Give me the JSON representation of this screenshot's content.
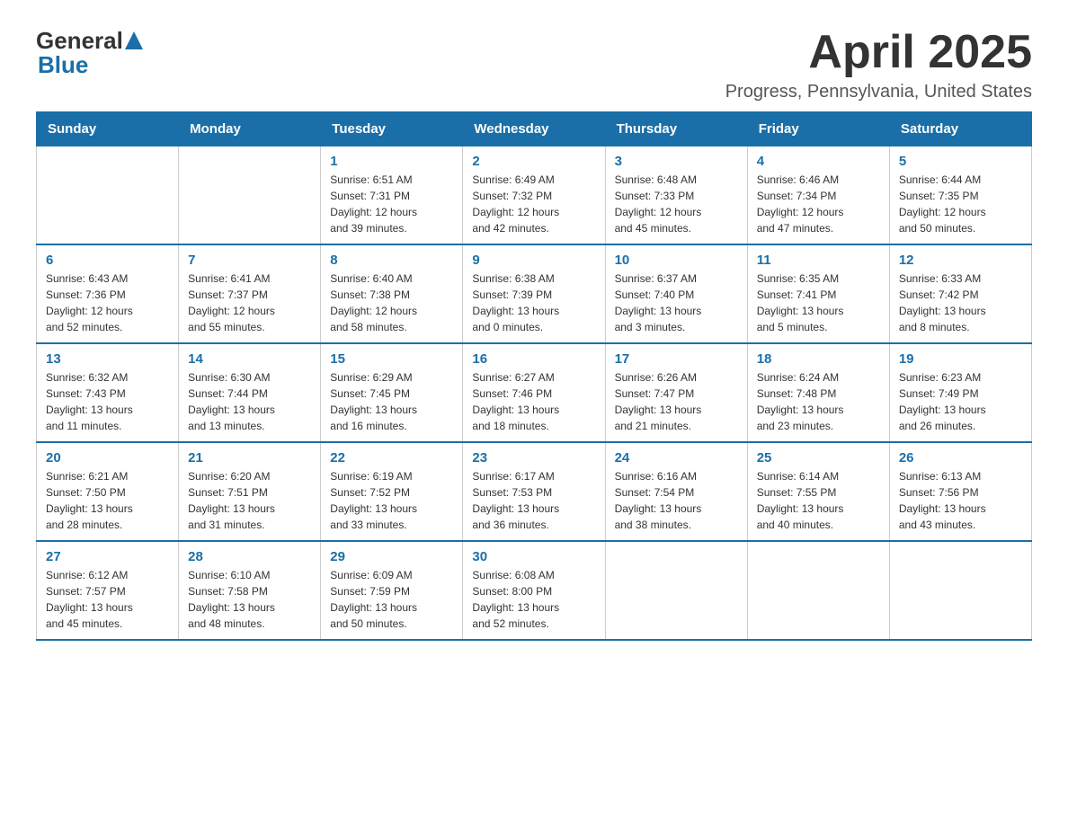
{
  "logo": {
    "general": "General",
    "triangle_color": "#1a6fa8",
    "blue": "Blue"
  },
  "title": "April 2025",
  "subtitle": "Progress, Pennsylvania, United States",
  "days_of_week": [
    "Sunday",
    "Monday",
    "Tuesday",
    "Wednesday",
    "Thursday",
    "Friday",
    "Saturday"
  ],
  "weeks": [
    [
      {
        "day": "",
        "info": ""
      },
      {
        "day": "",
        "info": ""
      },
      {
        "day": "1",
        "info": "Sunrise: 6:51 AM\nSunset: 7:31 PM\nDaylight: 12 hours\nand 39 minutes."
      },
      {
        "day": "2",
        "info": "Sunrise: 6:49 AM\nSunset: 7:32 PM\nDaylight: 12 hours\nand 42 minutes."
      },
      {
        "day": "3",
        "info": "Sunrise: 6:48 AM\nSunset: 7:33 PM\nDaylight: 12 hours\nand 45 minutes."
      },
      {
        "day": "4",
        "info": "Sunrise: 6:46 AM\nSunset: 7:34 PM\nDaylight: 12 hours\nand 47 minutes."
      },
      {
        "day": "5",
        "info": "Sunrise: 6:44 AM\nSunset: 7:35 PM\nDaylight: 12 hours\nand 50 minutes."
      }
    ],
    [
      {
        "day": "6",
        "info": "Sunrise: 6:43 AM\nSunset: 7:36 PM\nDaylight: 12 hours\nand 52 minutes."
      },
      {
        "day": "7",
        "info": "Sunrise: 6:41 AM\nSunset: 7:37 PM\nDaylight: 12 hours\nand 55 minutes."
      },
      {
        "day": "8",
        "info": "Sunrise: 6:40 AM\nSunset: 7:38 PM\nDaylight: 12 hours\nand 58 minutes."
      },
      {
        "day": "9",
        "info": "Sunrise: 6:38 AM\nSunset: 7:39 PM\nDaylight: 13 hours\nand 0 minutes."
      },
      {
        "day": "10",
        "info": "Sunrise: 6:37 AM\nSunset: 7:40 PM\nDaylight: 13 hours\nand 3 minutes."
      },
      {
        "day": "11",
        "info": "Sunrise: 6:35 AM\nSunset: 7:41 PM\nDaylight: 13 hours\nand 5 minutes."
      },
      {
        "day": "12",
        "info": "Sunrise: 6:33 AM\nSunset: 7:42 PM\nDaylight: 13 hours\nand 8 minutes."
      }
    ],
    [
      {
        "day": "13",
        "info": "Sunrise: 6:32 AM\nSunset: 7:43 PM\nDaylight: 13 hours\nand 11 minutes."
      },
      {
        "day": "14",
        "info": "Sunrise: 6:30 AM\nSunset: 7:44 PM\nDaylight: 13 hours\nand 13 minutes."
      },
      {
        "day": "15",
        "info": "Sunrise: 6:29 AM\nSunset: 7:45 PM\nDaylight: 13 hours\nand 16 minutes."
      },
      {
        "day": "16",
        "info": "Sunrise: 6:27 AM\nSunset: 7:46 PM\nDaylight: 13 hours\nand 18 minutes."
      },
      {
        "day": "17",
        "info": "Sunrise: 6:26 AM\nSunset: 7:47 PM\nDaylight: 13 hours\nand 21 minutes."
      },
      {
        "day": "18",
        "info": "Sunrise: 6:24 AM\nSunset: 7:48 PM\nDaylight: 13 hours\nand 23 minutes."
      },
      {
        "day": "19",
        "info": "Sunrise: 6:23 AM\nSunset: 7:49 PM\nDaylight: 13 hours\nand 26 minutes."
      }
    ],
    [
      {
        "day": "20",
        "info": "Sunrise: 6:21 AM\nSunset: 7:50 PM\nDaylight: 13 hours\nand 28 minutes."
      },
      {
        "day": "21",
        "info": "Sunrise: 6:20 AM\nSunset: 7:51 PM\nDaylight: 13 hours\nand 31 minutes."
      },
      {
        "day": "22",
        "info": "Sunrise: 6:19 AM\nSunset: 7:52 PM\nDaylight: 13 hours\nand 33 minutes."
      },
      {
        "day": "23",
        "info": "Sunrise: 6:17 AM\nSunset: 7:53 PM\nDaylight: 13 hours\nand 36 minutes."
      },
      {
        "day": "24",
        "info": "Sunrise: 6:16 AM\nSunset: 7:54 PM\nDaylight: 13 hours\nand 38 minutes."
      },
      {
        "day": "25",
        "info": "Sunrise: 6:14 AM\nSunset: 7:55 PM\nDaylight: 13 hours\nand 40 minutes."
      },
      {
        "day": "26",
        "info": "Sunrise: 6:13 AM\nSunset: 7:56 PM\nDaylight: 13 hours\nand 43 minutes."
      }
    ],
    [
      {
        "day": "27",
        "info": "Sunrise: 6:12 AM\nSunset: 7:57 PM\nDaylight: 13 hours\nand 45 minutes."
      },
      {
        "day": "28",
        "info": "Sunrise: 6:10 AM\nSunset: 7:58 PM\nDaylight: 13 hours\nand 48 minutes."
      },
      {
        "day": "29",
        "info": "Sunrise: 6:09 AM\nSunset: 7:59 PM\nDaylight: 13 hours\nand 50 minutes."
      },
      {
        "day": "30",
        "info": "Sunrise: 6:08 AM\nSunset: 8:00 PM\nDaylight: 13 hours\nand 52 minutes."
      },
      {
        "day": "",
        "info": ""
      },
      {
        "day": "",
        "info": ""
      },
      {
        "day": "",
        "info": ""
      }
    ]
  ]
}
